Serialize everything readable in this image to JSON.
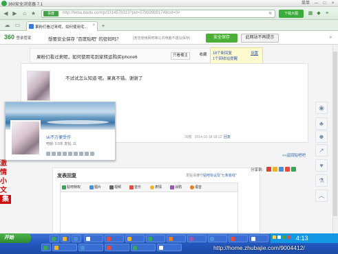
{
  "window": {
    "title": "360安全浏览器 7.1",
    "controls": {
      "menu": "菜单",
      "minimize": "—",
      "maximize": "□",
      "close": "×"
    }
  },
  "nav": {
    "site_badge": "百度",
    "url": "http://tieba.baidu.com/p/3314578313?pid=579339991748cid=0#",
    "zoom_label": "下载大图"
  },
  "tab": {
    "label": "果粉们看过来呢，如何使用宅..."
  },
  "security_bar": {
    "brand": "360",
    "brand_sub": "登录管家",
    "message": "想要安全保存 \"百度贴吧\" 的密码吗？",
    "note": "(若您使用网吧等公共电脑不建议保存)",
    "save_button": "安全保存",
    "no_hint_button": "此网站不再提示"
  },
  "forum": {
    "thread_title": "果粉们看过来呢，如何使用宅到家转运购买iphone6",
    "only_owner_button": "只看楼主",
    "collect_button": "收藏",
    "notify_line1": "18个新回复",
    "notify_line2": "1个回收站提醒",
    "notify_settings": "设置",
    "post_text": "不试试怎么知道 呢。果真不错。谢谢了",
    "post_meta_floor": "20楼",
    "post_meta_time": "2014-10-18 18:12",
    "post_meta_reply": "回复",
    "back_to_list": "<<返回贴吧吧"
  },
  "profile_card": {
    "username": "sk不方便受作",
    "stats": "吧龄: 0.5年    发帖: 11"
  },
  "side_red_text": {
    "line1": "激情",
    "line2": "小文",
    "line3": "集"
  },
  "share": {
    "label": "分享到:"
  },
  "reply": {
    "title": "发表回复",
    "rule_prefix": "发贴请遵守",
    "rule_link": "贴吧协议及\"七条底线\"",
    "tools": [
      "贴吧特权",
      "图片",
      "视频",
      "音乐",
      "表情",
      "涂鸦",
      "语音"
    ]
  },
  "taskbar": {
    "start_label": "开始",
    "clock": "4:13",
    "watermark": "http://home.zhubajie.com/9004412/"
  },
  "colors": {
    "brand_green": "#4caf35",
    "link_blue": "#3366aa",
    "taskbar_blue": "#2457be",
    "alert_red": "#cc1111"
  }
}
